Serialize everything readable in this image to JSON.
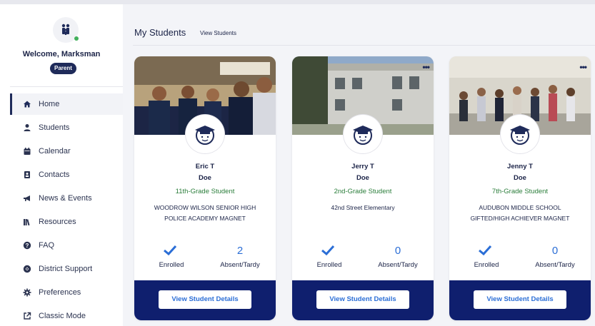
{
  "user": {
    "welcome": "Welcome, Marksman",
    "role": "Parent"
  },
  "nav": [
    {
      "label": "Home",
      "icon": "home-icon",
      "active": true
    },
    {
      "label": "Students",
      "icon": "person-icon"
    },
    {
      "label": "Calendar",
      "icon": "calendar-icon"
    },
    {
      "label": "Contacts",
      "icon": "contact-card-icon"
    },
    {
      "label": "News & Events",
      "icon": "megaphone-icon"
    },
    {
      "label": "Resources",
      "icon": "books-icon"
    },
    {
      "label": "FAQ",
      "icon": "question-icon"
    },
    {
      "label": "District Support",
      "icon": "support-icon"
    },
    {
      "label": "Preferences",
      "icon": "gear-icon"
    },
    {
      "label": "Classic Mode",
      "icon": "external-link-icon"
    }
  ],
  "header": {
    "title": "My Students",
    "link": "View Students"
  },
  "students": [
    {
      "first": "Eric T",
      "last": "Doe",
      "grade": "11th-Grade Student",
      "school": "WOODROW WILSON SENIOR HIGH POLICE ACADEMY MAGNET",
      "enrolled_label": "Enrolled",
      "absent_count": "2",
      "absent_label": "Absent/Tardy",
      "button": "View Student Details"
    },
    {
      "first": "Jerry T",
      "last": "Doe",
      "grade": "2nd-Grade Student",
      "school": "42nd Street Elementary",
      "enrolled_label": "Enrolled",
      "absent_count": "0",
      "absent_label": "Absent/Tardy",
      "button": "View Student Details"
    },
    {
      "first": "Jenny T",
      "last": "Doe",
      "grade": "7th-Grade Student",
      "school": "AUDUBON MIDDLE SCHOOL GIFTED/HIGH ACHIEVER MAGNET",
      "enrolled_label": "Enrolled",
      "absent_count": "0",
      "absent_label": "Absent/Tardy",
      "button": "View Student Details"
    }
  ],
  "colors": {
    "navy": "#0f1f6e",
    "accent_blue": "#2b6ed6",
    "grade_green": "#2a7d3a"
  }
}
